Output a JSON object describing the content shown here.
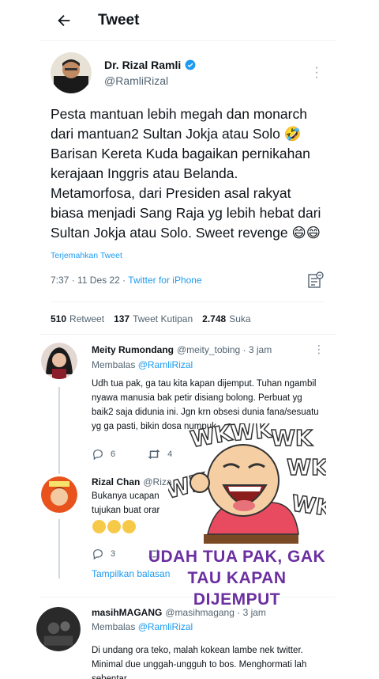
{
  "header": {
    "title": "Tweet"
  },
  "tweet": {
    "author_name": "Dr. Rizal Ramli",
    "author_handle": "@RamliRizal",
    "text": "Pesta mantuan lebih megah dan monarch dari mantuan2 Sultan Jokja atau Solo 🤣 Barisan Kereta Kuda bagaikan pernikahan kerajaan Inggris atau Belanda. Metamorfosa, dari Presiden asal rakyat biasa menjadi Sang Raja yg lebih hebat dari Sultan Jokja atau Solo. Sweet revenge 😄😄",
    "translate_label": "Terjemahkan Tweet",
    "time": "7:37 · 11 Des 22 · ",
    "source": "Twitter for iPhone"
  },
  "stats": {
    "retweets_count": "510",
    "retweets_label": "Retweet",
    "quotes_count": "137",
    "quotes_label": "Tweet Kutipan",
    "likes_count": "2.748",
    "likes_label": "Suka"
  },
  "replies": [
    {
      "name": "Meity Rumondang",
      "handle": "@meity_tobing · 3 jam",
      "replying_label": "Membalas ",
      "replying_to": "@RamliRizal",
      "text": "Udh tua pak, ga tau kita kapan dijemput. Tuhan ngambil nyawa manusia bak petir disiang bolong. Perbuat yg baik2 saja didunia ini. Jgn krn obsesi dunia fana/sesuatu yg ga pasti, bikin dosa numpuk.",
      "reply_count": "6",
      "retweet_count": "4"
    },
    {
      "name": "Rizal Chan",
      "handle": "@Riza",
      "text": "Bukanya ucapan",
      "text2": "tujukan buat orar",
      "reply_count": "3",
      "show_replies": "Tampilkan balasan"
    },
    {
      "name": "masihMAGANG",
      "handle": "@masihmagang · 3 jam",
      "replying_label": "Membalas ",
      "replying_to": "@RamliRizal",
      "text": "Di undang ora teko, malah kokean lambe nek twitter. Minimal due unggah-ungguh to bos. Menghormati lah sebentar."
    }
  ],
  "overlay": {
    "caption_line1": "UDAH TUA PAK, GAK",
    "caption_line2": "TAU KAPAN",
    "caption_line3": "DIJEMPUT",
    "sticker_text": "WK"
  },
  "colors": {
    "accent": "#1d9bf0",
    "text": "#0f1419",
    "muted": "#536471",
    "caption": "#6b2fa0"
  }
}
